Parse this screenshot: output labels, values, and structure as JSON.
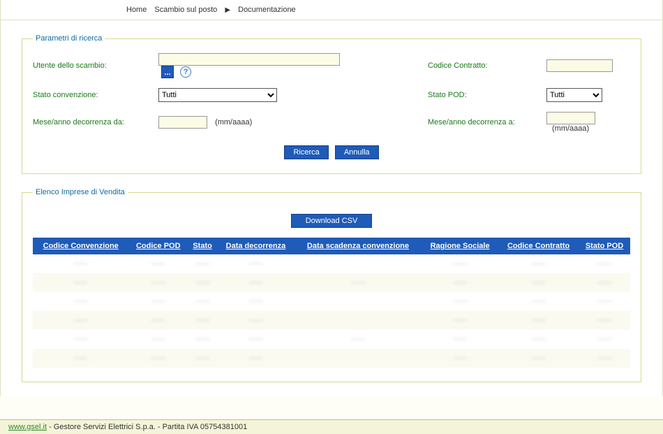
{
  "breadcrumb": {
    "home": "Home",
    "mid": "Scambio sul posto",
    "last": "Documentazione"
  },
  "search": {
    "legend": "Parametri di ricerca",
    "utente_label": "Utente dello scambio:",
    "utente_value": "",
    "codice_contratto_label": "Codice Contratto:",
    "codice_contratto_value": "",
    "stato_conv_label": "Stato convenzione:",
    "stato_conv_value": "Tutti",
    "stato_pod_label": "Stato POD:",
    "stato_pod_value": "Tutti",
    "decorr_da_label": "Mese/anno decorrenza da:",
    "decorr_da_value": "",
    "decorr_a_label": "Mese/anno decorrenza a:",
    "decorr_a_value": "",
    "mm_hint": "(mm/aaaa)",
    "btn_ricerca": "Ricerca",
    "btn_annulla": "Annulla",
    "btn_lookup": "...",
    "help": "?"
  },
  "list": {
    "legend": "Elenco Imprese di Vendita",
    "btn_download": "Download CSV",
    "headers": {
      "cod_conv": "Codice Convenzione",
      "cod_pod": "Codice POD",
      "stato": "Stato",
      "data_dec": "Data decorrenza",
      "data_scad": "Data scadenza convenzione",
      "rag_soc": "Ragione Sociale",
      "cod_contr": "Codice Contratto",
      "stato_pod": "Stato POD"
    },
    "rows": [
      {
        "a": "——",
        "b": "——",
        "c": "——",
        "d": "——",
        "e": "",
        "f": "——",
        "g": "——",
        "h": "——"
      },
      {
        "a": "——",
        "b": "——",
        "c": "——",
        "d": "——",
        "e": "——",
        "f": "——",
        "g": "——",
        "h": "——"
      },
      {
        "a": "——",
        "b": "——",
        "c": "——",
        "d": "——",
        "e": "",
        "f": "——",
        "g": "——",
        "h": "——"
      },
      {
        "a": "——",
        "b": "——",
        "c": "——",
        "d": "——",
        "e": "",
        "f": "——",
        "g": "——",
        "h": "——"
      },
      {
        "a": "——",
        "b": "——",
        "c": "——",
        "d": "——",
        "e": "——",
        "f": "——",
        "g": "——",
        "h": "——"
      },
      {
        "a": "——",
        "b": "——",
        "c": "——",
        "d": "——",
        "e": "",
        "f": "——",
        "g": "——",
        "h": "——"
      }
    ]
  },
  "footer": {
    "link": "www.gsel.it",
    "text": " - Gestore Servizi Elettrici S.p.a. - Partita IVA 05754381001"
  }
}
